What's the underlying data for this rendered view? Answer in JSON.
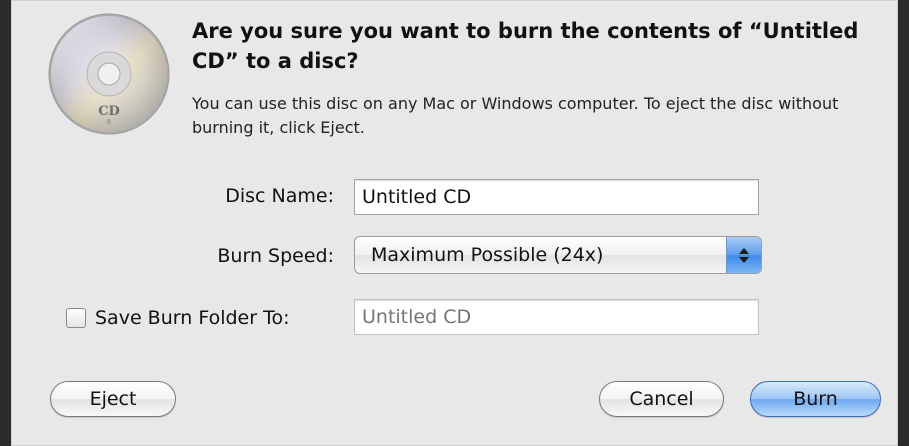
{
  "dialog": {
    "title": "Are you sure you want to burn the contents of “Untitled CD” to a disc?",
    "message": "You can use this disc on any Mac or Windows computer. To eject the disc without burning it, click Eject.",
    "disc_icon_label": "CD",
    "disc_icon_sublabel": "R"
  },
  "form": {
    "disc_name_label": "Disc Name:",
    "disc_name_value": "Untitled CD",
    "burn_speed_label": "Burn Speed:",
    "burn_speed_value": "Maximum Possible (24x)",
    "save_folder_label": "Save Burn Folder To:",
    "save_folder_checked": false,
    "save_folder_placeholder": "Untitled CD"
  },
  "buttons": {
    "eject": "Eject",
    "cancel": "Cancel",
    "burn": "Burn"
  },
  "colors": {
    "default_button": "#6ea9ef",
    "dialog_background": "#e8e8e8"
  }
}
